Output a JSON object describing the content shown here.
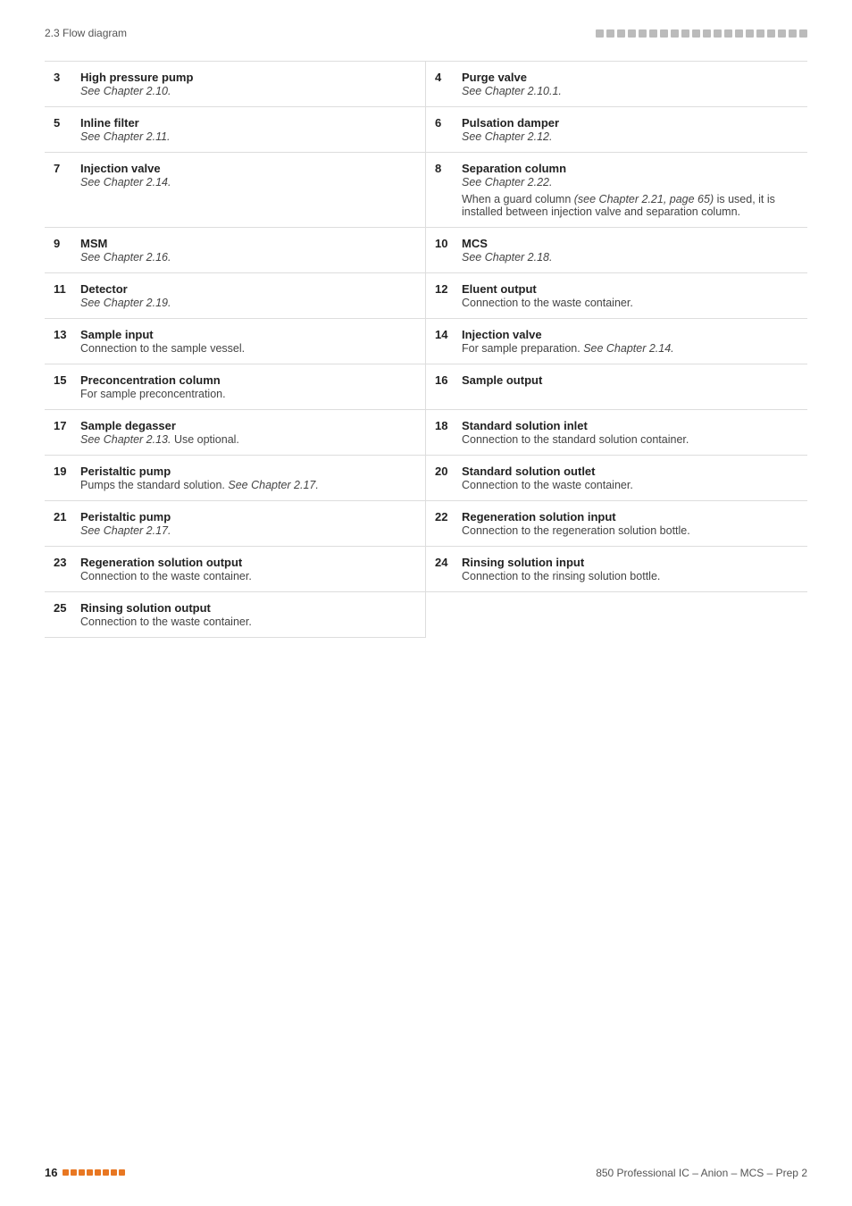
{
  "header": {
    "left": "2.3 Flow diagram",
    "dots_count": 20
  },
  "items": [
    {
      "num": "3",
      "title": "High pressure pump",
      "desc_italic": "See Chapter 2.10.",
      "desc_normal": null,
      "desc_extra": null,
      "tall": false
    },
    {
      "num": "4",
      "title": "Purge valve",
      "desc_italic": "See Chapter 2.10.1.",
      "desc_normal": null,
      "desc_extra": null,
      "tall": false
    },
    {
      "num": "5",
      "title": "Inline filter",
      "desc_italic": "See Chapter 2.11.",
      "desc_normal": null,
      "desc_extra": null,
      "tall": false
    },
    {
      "num": "6",
      "title": "Pulsation damper",
      "desc_italic": "See Chapter 2.12.",
      "desc_normal": null,
      "desc_extra": null,
      "tall": false
    },
    {
      "num": "7",
      "title": "Injection valve",
      "desc_italic": "See Chapter 2.14.",
      "desc_normal": null,
      "desc_extra": null,
      "tall": true
    },
    {
      "num": "8",
      "title": "Separation column",
      "desc_italic": "See Chapter 2.22.",
      "desc_normal": null,
      "desc_extra": "When a guard column (see Chapter 2.21, page 65) is used, it is installed between injection valve and separation column.",
      "desc_extra_italic_part": "see Chapter 2.21, page 65",
      "tall": false
    },
    {
      "num": "9",
      "title": "MSM",
      "desc_italic": "See Chapter 2.16.",
      "desc_normal": null,
      "desc_extra": null,
      "tall": false
    },
    {
      "num": "10",
      "title": "MCS",
      "desc_italic": "See Chapter 2.18.",
      "desc_normal": null,
      "desc_extra": null,
      "tall": false
    },
    {
      "num": "11",
      "title": "Detector",
      "desc_italic": "See Chapter 2.19.",
      "desc_normal": null,
      "desc_extra": null,
      "tall": false
    },
    {
      "num": "12",
      "title": "Eluent output",
      "desc_italic": null,
      "desc_normal": "Connection to the waste container.",
      "desc_extra": null,
      "tall": false
    },
    {
      "num": "13",
      "title": "Sample input",
      "desc_italic": null,
      "desc_normal": "Connection to the sample vessel.",
      "desc_extra": null,
      "tall": false
    },
    {
      "num": "14",
      "title": "Injection valve",
      "desc_italic": null,
      "desc_normal": "For sample preparation.",
      "desc_extra": null,
      "desc_mixed": "For sample preparation. See Chapter 2.14.",
      "desc_mixed_italic": "See Chapter 2.14.",
      "tall": false
    },
    {
      "num": "15",
      "title": "Preconcentration column",
      "desc_italic": null,
      "desc_normal": "For sample preconcentration.",
      "desc_extra": null,
      "tall": false
    },
    {
      "num": "16",
      "title": "Sample output",
      "desc_italic": null,
      "desc_normal": null,
      "desc_extra": null,
      "tall": false
    },
    {
      "num": "17",
      "title": "Sample degasser",
      "desc_italic": null,
      "desc_normal": null,
      "desc_mixed": "See Chapter 2.13. Use optional.",
      "desc_mixed_italic": "See Chapter 2.13.",
      "desc_mixed_normal": "Use optional.",
      "desc_extra": null,
      "tall": false
    },
    {
      "num": "18",
      "title": "Standard solution inlet",
      "desc_italic": null,
      "desc_normal": "Connection to the standard solution container.",
      "desc_extra": null,
      "tall": false
    },
    {
      "num": "19",
      "title": "Peristaltic pump",
      "desc_italic": null,
      "desc_mixed": "Pumps the standard solution. See Chapter 2.17.",
      "desc_mixed_italic": "See Chapter 2.17.",
      "desc_mixed_normal": "Pumps the standard solution.",
      "desc_extra": null,
      "tall": false
    },
    {
      "num": "20",
      "title": "Standard solution outlet",
      "desc_italic": null,
      "desc_normal": "Connection to the waste container.",
      "desc_extra": null,
      "tall": false
    },
    {
      "num": "21",
      "title": "Peristaltic pump",
      "desc_italic": "See Chapter 2.17.",
      "desc_normal": null,
      "desc_extra": null,
      "tall": false
    },
    {
      "num": "22",
      "title": "Regeneration solution input",
      "desc_italic": null,
      "desc_normal": "Connection to the regeneration solution bottle.",
      "desc_extra": null,
      "tall": false
    },
    {
      "num": "23",
      "title": "Regeneration solution output",
      "desc_italic": null,
      "desc_normal": "Connection to the waste container.",
      "desc_extra": null,
      "tall": false
    },
    {
      "num": "24",
      "title": "Rinsing solution input",
      "desc_italic": null,
      "desc_normal": "Connection to the rinsing solution bottle.",
      "desc_extra": null,
      "tall": false
    },
    {
      "num": "25",
      "title": "Rinsing solution output",
      "desc_italic": null,
      "desc_normal": "Connection to the waste container.",
      "desc_extra": null,
      "tall": false
    }
  ],
  "footer": {
    "page_num": "16",
    "dots_count": 8,
    "right_text": "850 Professional IC – Anion – MCS – Prep 2"
  }
}
